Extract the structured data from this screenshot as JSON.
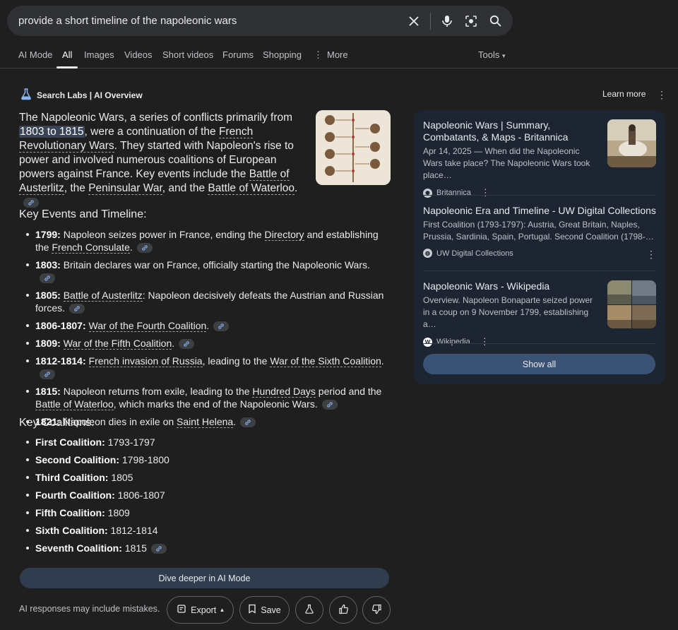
{
  "search": {
    "query": "provide a short timeline of the napoleonic wars"
  },
  "tabs": [
    "AI Mode",
    "All",
    "Images",
    "Videos",
    "Short videos",
    "Forums",
    "Shopping",
    "More"
  ],
  "tools_label": "Tools",
  "overview": {
    "header": "Search Labs | AI Overview",
    "learn_more": "Learn more",
    "intro": {
      "p1": "The Napoleonic Wars, a series of conflicts primarily from ",
      "highlight": "1803 to 1815",
      "p2": ", were a continuation of the ",
      "link1": "French Revolutionary Wars",
      "p3": ". They started with Napoleon's rise to power and involved numerous coalitions of European powers against France. Key events include the ",
      "link2": "Battle of Austerlitz",
      "p4": ", the ",
      "link3": "Peninsular War",
      "p5": ", and the ",
      "link4": "Battle of Waterloo",
      "p6": "."
    },
    "events_heading": "Key Events and Timeline:",
    "events": [
      {
        "year": "1799:",
        "a": " Napoleon seizes power in France, ending the ",
        "l1": "Directory",
        "b": " and establishing the ",
        "l2": "French Consulate",
        "c": "."
      },
      {
        "year": "1803:",
        "a": " Britain declares war on France, officially starting the Napoleonic Wars."
      },
      {
        "year": "1805:",
        "l1": "Battle of Austerlitz",
        "a": ": Napoleon decisively defeats the Austrian and Russian forces."
      },
      {
        "year": "1806-1807:",
        "l1": "War of the Fourth Coalition",
        "a": "."
      },
      {
        "year": "1809:",
        "l1": "War of the Fifth Coalition",
        "a": "."
      },
      {
        "year": "1812-1814:",
        "l1": "French invasion of Russia",
        "a": ", leading to the ",
        "l2": "War of the Sixth Coalition",
        "b": "."
      },
      {
        "year": "1815:",
        "a": " Napoleon returns from exile, leading to the ",
        "l1": "Hundred Days",
        "b": " period and the ",
        "l2": "Battle of Waterloo",
        "c": ", which marks the end of the Napoleonic Wars."
      },
      {
        "year": "1821:",
        "a": " Napoleon dies in exile on ",
        "l1": "Saint Helena",
        "b": "."
      }
    ],
    "coalitions_heading": "Key Coalitions:",
    "coalitions": [
      {
        "name": "First Coalition:",
        "years": " 1793-1797"
      },
      {
        "name": "Second Coalition:",
        "years": " 1798-1800"
      },
      {
        "name": "Third Coalition:",
        "years": " 1805"
      },
      {
        "name": "Fourth Coalition:",
        "years": " 1806-1807"
      },
      {
        "name": "Fifth Coalition:",
        "years": " 1809"
      },
      {
        "name": "Sixth Coalition:",
        "years": " 1812-1814"
      },
      {
        "name": "Seventh Coalition:",
        "years": " 1815"
      }
    ],
    "dive_deeper": "Dive deeper in AI Mode",
    "disclaimer": "AI responses may include mistakes.",
    "export_label": "Export",
    "save_label": "Save"
  },
  "sources": [
    {
      "title": "Napoleonic Wars | Summary, Combatants, & Maps - Britannica",
      "snippet": "Apr 14, 2025 — When did the Napoleonic Wars take place? The Napoleonic Wars took place…",
      "site": "Britannica"
    },
    {
      "title": "Napoleonic Era and Timeline - UW Digital Collections",
      "snippet": "First Coalition (1793-1797): Austria, Great Britain, Naples, Prussia, Sardinia, Spain, Portugal. Second Coalition (1798-…",
      "site": "UW Digital Collections"
    },
    {
      "title": "Napoleonic Wars - Wikipedia",
      "snippet": "Overview. Napoleon Bonaparte seized power in a coup on 9 November 1799, establishing a…",
      "site": "Wikipedia"
    }
  ],
  "show_all": "Show all"
}
